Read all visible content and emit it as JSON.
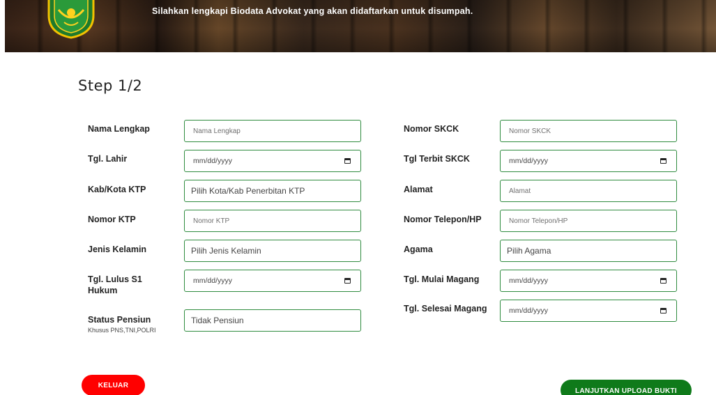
{
  "banner": {
    "text": "Silahkan lengkapi Biodata Advokat yang akan didaftarkan untuk disumpah."
  },
  "step_title": "Step 1/2",
  "left_fields": [
    {
      "label": "Nama Lengkap",
      "type": "text",
      "placeholder": "Nama Lengkap"
    },
    {
      "label": "Tgl. Lahir",
      "type": "date",
      "placeholder": "mm/dd/yyyy"
    },
    {
      "label": "Kab/Kota KTP",
      "type": "select",
      "value": "Pilih Kota/Kab Penerbitan KTP"
    },
    {
      "label": "Nomor KTP",
      "type": "text",
      "placeholder": "Nomor KTP"
    },
    {
      "label": "Jenis Kelamin",
      "type": "select",
      "value": "Pilih Jenis Kelamin"
    },
    {
      "label": "Tgl. Lulus S1 Hukum",
      "type": "date",
      "placeholder": "mm/dd/yyyy"
    },
    {
      "label": "Status Pensiun",
      "sublabel": "Khusus PNS,TNI,POLRI",
      "type": "select",
      "value": "Tidak Pensiun"
    }
  ],
  "right_fields": [
    {
      "label": "Nomor SKCK",
      "type": "text",
      "placeholder": "Nomor SKCK"
    },
    {
      "label": "Tgl Terbit SKCK",
      "type": "date",
      "placeholder": "mm/dd/yyyy"
    },
    {
      "label": "Alamat",
      "type": "text",
      "placeholder": "Alamat"
    },
    {
      "label": "Nomor Telepon/HP",
      "type": "text",
      "placeholder": "Nomor Telepon/HP"
    },
    {
      "label": "Agama",
      "type": "select",
      "value": "Pilih Agama"
    },
    {
      "label": "Tgl. Mulai Magang",
      "type": "date",
      "placeholder": "mm/dd/yyyy"
    },
    {
      "label": "Tgl. Selesai Magang",
      "type": "date",
      "placeholder": "mm/dd/yyyy"
    }
  ],
  "buttons": {
    "logout": "KELUAR",
    "next": "LANJUTKAN UPLOAD BUKTI"
  },
  "colors": {
    "field_border": "#2e8b3e",
    "logout_bg": "#ff0000",
    "next_bg": "#0f7a1a"
  },
  "icons": {
    "emblem": "court-emblem-logo",
    "date": "calendar-icon"
  }
}
